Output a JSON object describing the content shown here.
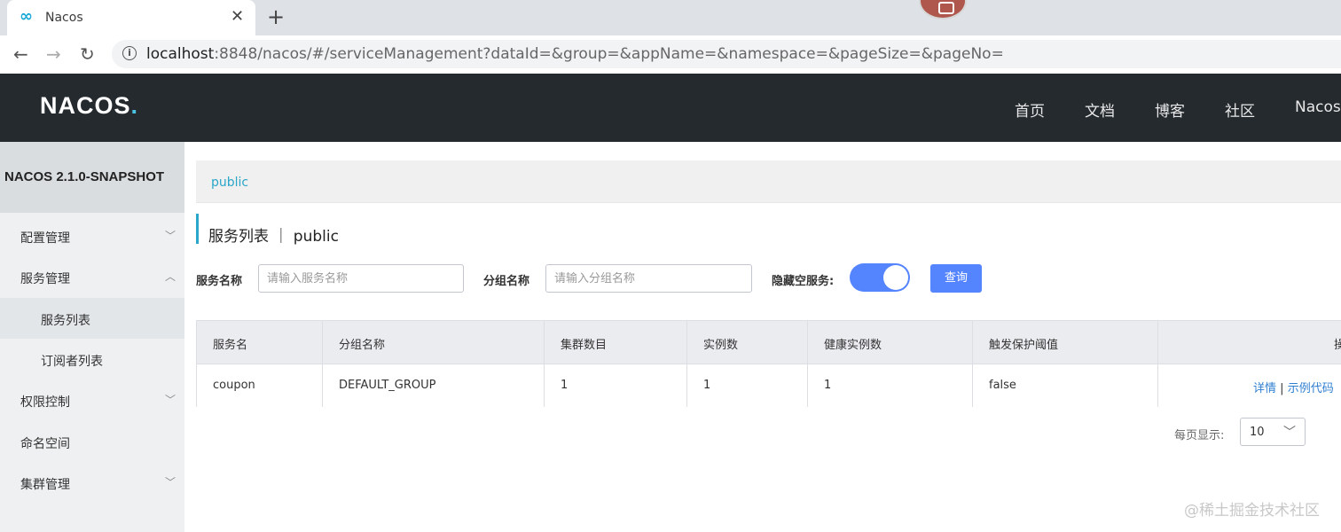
{
  "browser": {
    "tab_title": "Nacos",
    "tab_favicon": "∞",
    "tab_close": "✕",
    "new_tab": "+",
    "url_host": "localhost",
    "url_rest": ":8848/nacos/#/serviceManagement?dataId=&group=&appName=&namespace=&pageSize=&pageNo=",
    "back": "←",
    "forward": "→",
    "reload": "↻"
  },
  "header": {
    "logo_main": "NACOS",
    "logo_dot": ".",
    "nav": [
      "首页",
      "文档",
      "博客",
      "社区",
      "Nacos"
    ]
  },
  "sidebar": {
    "version": "NACOS 2.1.0-SNAPSHOT",
    "items": [
      {
        "label": "配置管理",
        "chevron": "﹀"
      },
      {
        "label": "服务管理",
        "chevron": "︿"
      },
      {
        "label": "服务列表"
      },
      {
        "label": "订阅者列表"
      },
      {
        "label": "权限控制",
        "chevron": "﹀"
      },
      {
        "label": "命名空间"
      },
      {
        "label": "集群管理",
        "chevron": "﹀"
      }
    ]
  },
  "main": {
    "breadcrumb": "public",
    "page_title": "服务列表 ｜ public",
    "form": {
      "service_name_label": "服务名称",
      "service_name_placeholder": "请输入服务名称",
      "group_name_label": "分组名称",
      "group_name_placeholder": "请输入分组名称",
      "hide_empty_label": "隐藏空服务:",
      "hide_empty_on": true,
      "search_label": "查询"
    },
    "table": {
      "headers": [
        "服务名",
        "分组名称",
        "集群数目",
        "实例数",
        "健康实例数",
        "触发保护阈值",
        "操"
      ],
      "rows": [
        [
          "coupon",
          "DEFAULT_GROUP",
          "1",
          "1",
          "1",
          "false"
        ]
      ],
      "actions": {
        "detail": "详情",
        "sep": "|",
        "sample": "示例代码"
      }
    },
    "pager": {
      "label": "每页显示:",
      "page_size": "10",
      "arrow": "﹀"
    }
  },
  "watermark": "@稀土掘金技术社区",
  "colors": {
    "accent": "#5584ff",
    "brand": "#2aa6c9",
    "header_bg": "#252a2f"
  }
}
